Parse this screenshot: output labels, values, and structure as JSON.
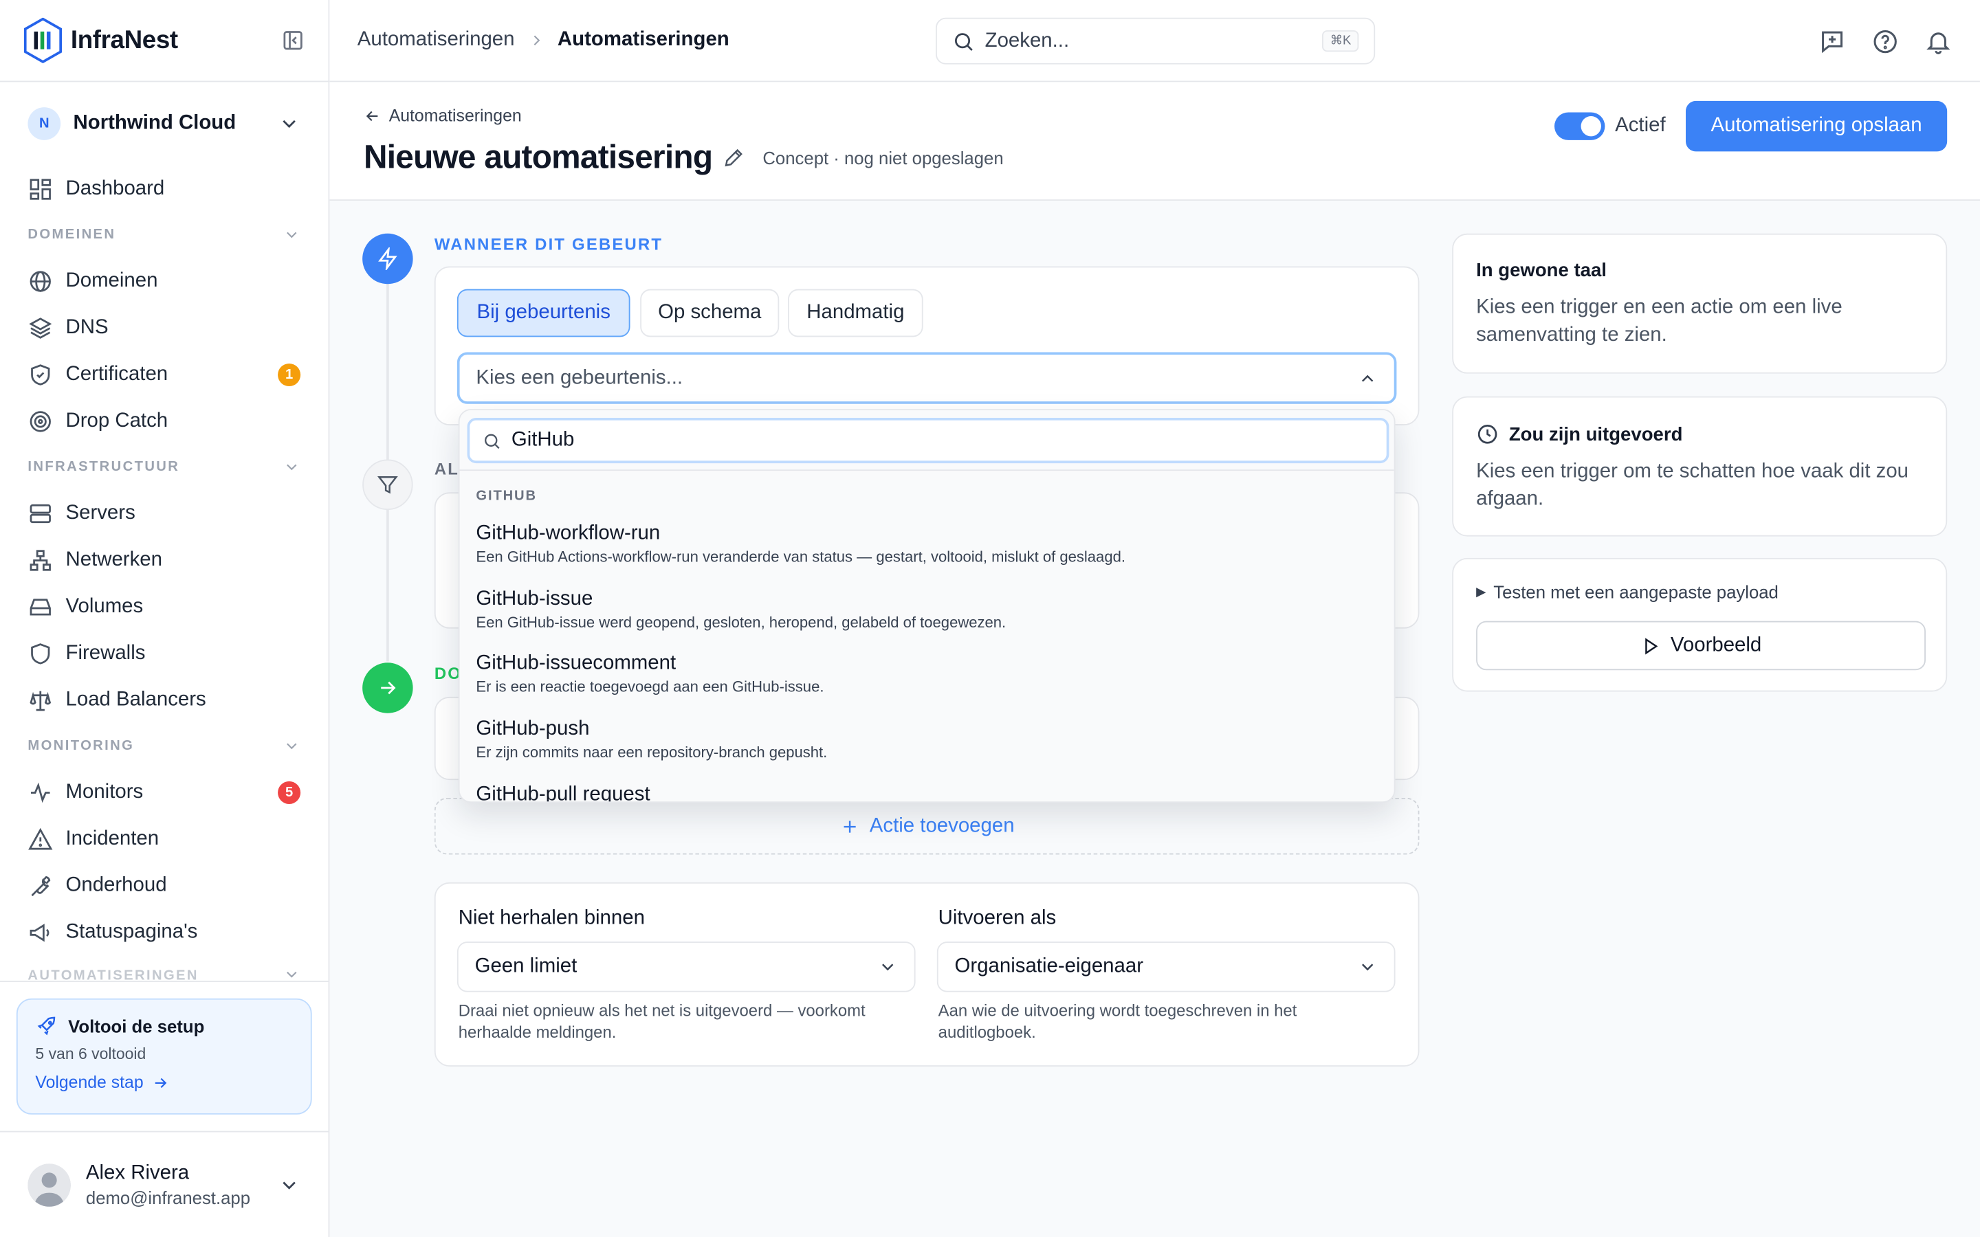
{
  "brand": {
    "name": "InfraNest"
  },
  "org": {
    "initial": "N",
    "name": "Northwind Cloud"
  },
  "sidebar": {
    "top_items": [
      {
        "label": "Dashboard",
        "icon": "dashboard-icon"
      }
    ],
    "sections": [
      {
        "label": "DOMEINEN",
        "items": [
          {
            "label": "Domeinen",
            "icon": "globe-icon"
          },
          {
            "label": "DNS",
            "icon": "layers-icon"
          },
          {
            "label": "Certificaten",
            "icon": "shield-check-icon",
            "badge": "1",
            "badge_color": "#f59e0b"
          },
          {
            "label": "Drop Catch",
            "icon": "target-icon"
          }
        ]
      },
      {
        "label": "INFRASTRUCTUUR",
        "items": [
          {
            "label": "Servers",
            "icon": "server-icon"
          },
          {
            "label": "Netwerken",
            "icon": "network-icon"
          },
          {
            "label": "Volumes",
            "icon": "drive-icon"
          },
          {
            "label": "Firewalls",
            "icon": "shield-icon"
          },
          {
            "label": "Load Balancers",
            "icon": "scale-icon"
          }
        ]
      },
      {
        "label": "MONITORING",
        "items": [
          {
            "label": "Monitors",
            "icon": "activity-icon",
            "badge": "5",
            "badge_color": "#ef4444"
          },
          {
            "label": "Incidenten",
            "icon": "alert-triangle-icon"
          },
          {
            "label": "Onderhoud",
            "icon": "wrench-icon"
          },
          {
            "label": "Statuspagina's",
            "icon": "megaphone-icon"
          }
        ]
      },
      {
        "label": "AUTOMATISERINGEN",
        "items": []
      }
    ],
    "setup": {
      "title": "Voltooi de setup",
      "progress": "5 van 6 voltooid",
      "next": "Volgende stap"
    },
    "user": {
      "name": "Alex Rivera",
      "email": "demo@infranest.app"
    }
  },
  "topbar": {
    "breadcrumb": [
      "Automatiseringen",
      "Automatiseringen"
    ],
    "search_placeholder": "Zoeken...",
    "search_shortcut": "⌘K"
  },
  "header": {
    "back_label": "Automatiseringen",
    "title": "Nieuwe automatisering",
    "status": "Concept · nog niet opgeslagen",
    "active_label": "Actief",
    "active": true,
    "save_label": "Automatisering opslaan"
  },
  "trigger": {
    "section_label": "WANNEER DIT GEBEURT",
    "modes": [
      "Bij gebeurtenis",
      "Op schema",
      "Handmatig"
    ],
    "active_mode": "Bij gebeurtenis",
    "select_placeholder": "Kies een gebeurtenis...",
    "dropdown": {
      "search_value": "GitHub",
      "group_label": "GITHUB",
      "items": [
        {
          "title": "GitHub-workflow-run",
          "desc": "Een GitHub Actions-workflow-run veranderde van status — gestart, voltooid, mislukt of geslaagd."
        },
        {
          "title": "GitHub-issue",
          "desc": "Een GitHub-issue werd geopend, gesloten, heropend, gelabeld of toegewezen."
        },
        {
          "title": "GitHub-issuecomment",
          "desc": "Er is een reactie toegevoegd aan een GitHub-issue."
        },
        {
          "title": "GitHub-push",
          "desc": "Er zijn commits naar een repository-branch gepusht."
        },
        {
          "title": "GitHub-pull request",
          "desc": ""
        }
      ]
    }
  },
  "conditions": {
    "section_label": "AL"
  },
  "actions": {
    "section_label": "DO",
    "add_label": "Actie toevoegen"
  },
  "options": {
    "no_repeat": {
      "label": "Niet herhalen binnen",
      "value": "Geen limiet",
      "help": "Draai niet opnieuw als het net is uitgevoerd — voorkomt herhaalde meldingen."
    },
    "run_as": {
      "label": "Uitvoeren als",
      "value": "Organisatie-eigenaar",
      "help": "Aan wie de uitvoering wordt toegeschreven in het auditlogboek."
    }
  },
  "panel": {
    "plain": {
      "title": "In gewone taal",
      "body": "Kies een trigger en een actie om een live samenvatting te zien."
    },
    "would_run": {
      "title": "Zou zijn uitgevoerd",
      "body": "Kies een trigger om te schatten hoe vaak dit zou afgaan."
    },
    "test": {
      "toggle_label": "Testen met een aangepaste payload",
      "preview_label": "Voorbeeld"
    }
  },
  "colors": {
    "accent": "#3b82f6",
    "success": "#22c55e"
  }
}
